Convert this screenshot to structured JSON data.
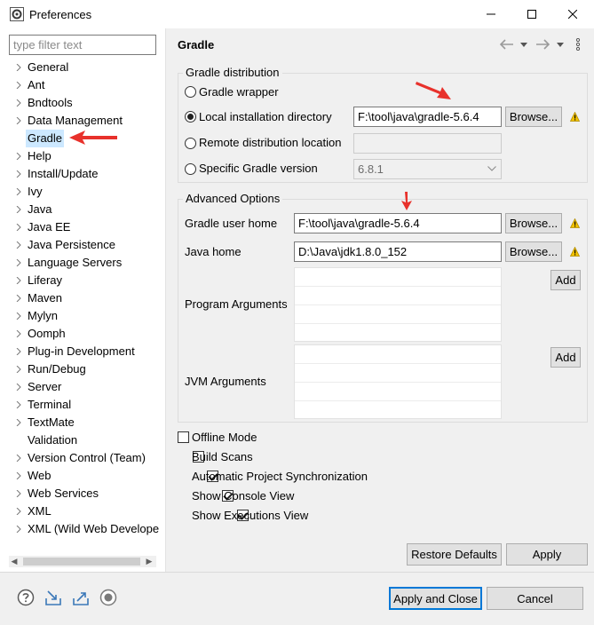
{
  "window": {
    "title": "Preferences"
  },
  "filter": {
    "placeholder": "type filter text"
  },
  "tree": [
    {
      "label": "General",
      "expandable": true
    },
    {
      "label": "Ant",
      "expandable": true
    },
    {
      "label": "Bndtools",
      "expandable": true
    },
    {
      "label": "Data Management",
      "expandable": true
    },
    {
      "label": "Gradle",
      "expandable": false,
      "selected": true
    },
    {
      "label": "Help",
      "expandable": true
    },
    {
      "label": "Install/Update",
      "expandable": true
    },
    {
      "label": "Ivy",
      "expandable": true
    },
    {
      "label": "Java",
      "expandable": true
    },
    {
      "label": "Java EE",
      "expandable": true
    },
    {
      "label": "Java Persistence",
      "expandable": true
    },
    {
      "label": "Language Servers",
      "expandable": true
    },
    {
      "label": "Liferay",
      "expandable": true
    },
    {
      "label": "Maven",
      "expandable": true
    },
    {
      "label": "Mylyn",
      "expandable": true
    },
    {
      "label": "Oomph",
      "expandable": true
    },
    {
      "label": "Plug-in Development",
      "expandable": true
    },
    {
      "label": "Run/Debug",
      "expandable": true
    },
    {
      "label": "Server",
      "expandable": true
    },
    {
      "label": "Terminal",
      "expandable": true
    },
    {
      "label": "TextMate",
      "expandable": true
    },
    {
      "label": "Validation",
      "expandable": false
    },
    {
      "label": "Version Control (Team)",
      "expandable": true
    },
    {
      "label": "Web",
      "expandable": true
    },
    {
      "label": "Web Services",
      "expandable": true
    },
    {
      "label": "XML",
      "expandable": true
    },
    {
      "label": "XML (Wild Web Develope",
      "expandable": true
    }
  ],
  "page": {
    "title": "Gradle"
  },
  "distribution": {
    "legend": "Gradle distribution",
    "wrapper_label": "Gradle wrapper",
    "local_label": "Local installation directory",
    "local_value": "F:\\tool\\java\\gradle-5.6.4",
    "remote_label": "Remote distribution location",
    "remote_value": "",
    "specific_label": "Specific Gradle version",
    "specific_value": "6.8.1",
    "selected": "local"
  },
  "advanced": {
    "legend": "Advanced Options",
    "user_home_label": "Gradle user home",
    "user_home_value": "F:\\tool\\java\\gradle-5.6.4",
    "java_home_label": "Java home",
    "java_home_value": "D:\\Java\\jdk1.8.0_152",
    "program_args_label": "Program Arguments",
    "jvm_args_label": "JVM Arguments"
  },
  "buttons": {
    "browse": "Browse...",
    "add": "Add",
    "restore_defaults": "Restore Defaults",
    "apply": "Apply",
    "apply_close": "Apply and Close",
    "cancel": "Cancel"
  },
  "options": [
    {
      "label": "Offline Mode",
      "checked": false
    },
    {
      "label": "Build Scans",
      "checked": false
    },
    {
      "label": "Automatic Project Synchronization",
      "checked": true
    },
    {
      "label": "Show Console View",
      "checked": true
    },
    {
      "label": "Show Executions View",
      "checked": true
    }
  ],
  "colors": {
    "annotation_arrow": "#e8312b",
    "warning": "#f2c200",
    "selection": "#cce8ff",
    "primary_border": "#0078d7"
  }
}
